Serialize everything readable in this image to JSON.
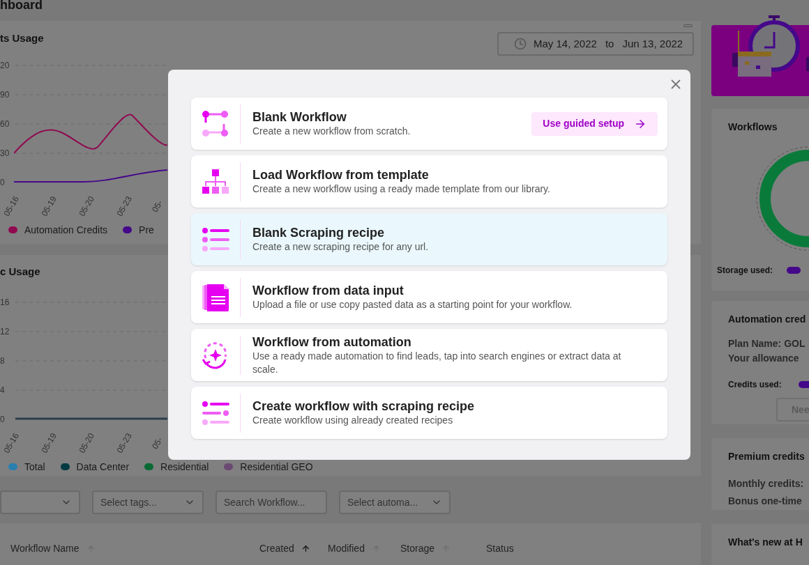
{
  "page_title": "hboard",
  "credits_chart": {
    "title": "ts Usage",
    "date_from": "May 14, 2022",
    "date_sep": "to",
    "date_to": "Jun 13, 2022",
    "y_ticks": [
      "20",
      "90",
      "60",
      "30",
      "0"
    ],
    "x_ticks": [
      "05-16",
      "05-19",
      "05-20",
      "05-23",
      "05-"
    ],
    "legend": [
      {
        "label": "Automation Credits",
        "color": "#8f0a50"
      },
      {
        "label": "Pre",
        "color": "#45088a"
      }
    ]
  },
  "traffic_chart": {
    "title": "c Usage",
    "y_ticks": [
      "16",
      "12",
      "8",
      "4",
      "0"
    ],
    "x_ticks": [
      "05-16",
      "05-19",
      "05-20",
      "05-23",
      "05-"
    ],
    "legend": [
      {
        "label": "Total",
        "color": "#2a7fb0"
      },
      {
        "label": "Data Center",
        "color": "#053a42"
      },
      {
        "label": "Residential",
        "color": "#0a6a34"
      },
      {
        "label": "Residential GEO",
        "color": "#6a4a72"
      }
    ]
  },
  "filters": [
    {
      "kind": "select"
    },
    {
      "kind": "select",
      "placeholder": "Select tags..."
    },
    {
      "kind": "search",
      "placeholder": "Search Workflow..."
    },
    {
      "kind": "select",
      "placeholder": "Select automa..."
    }
  ],
  "table": {
    "columns": [
      {
        "label": "Workflow Name",
        "sorted": false
      },
      {
        "label": "Created",
        "sorted": true
      },
      {
        "label": "Modified",
        "sorted": false
      },
      {
        "label": "Storage",
        "sorted": false
      },
      {
        "label": "Status"
      }
    ]
  },
  "side": {
    "workflows": {
      "title": "Workflows",
      "storage_label": "Storage used:"
    },
    "automation": {
      "title": "Automation cred",
      "plan": "Plan Name: GOL",
      "allowance": "Your allowance",
      "credits_label": "Credits used:",
      "button": "Nee"
    },
    "premium": {
      "title": "Premium credits",
      "monthly": "Monthly credits:",
      "bonus": "Bonus one-time"
    },
    "news": {
      "title": "What's new at H"
    }
  },
  "modal": {
    "options": [
      {
        "kind": "nodes",
        "title": "Blank Workflow",
        "description": "Create a new workflow from scratch.",
        "selected": false,
        "action": "Use guided setup"
      },
      {
        "kind": "hierarchy",
        "title": "Load Workflow from template",
        "description": "Create a new workflow using a ready made template from our library.",
        "selected": false
      },
      {
        "kind": "list",
        "title": "Blank Scraping recipe",
        "description": "Create a new scraping recipe for any url.",
        "selected": true
      },
      {
        "kind": "document",
        "title": "Workflow from data input",
        "description": "Upload a file or use copy pasted data as a starting point for your workflow.",
        "selected": false
      },
      {
        "kind": "automation",
        "title": "Workflow from automation",
        "description": "Use a ready made automation to find leads, tap into search engines or extract data at scale.",
        "selected": false
      },
      {
        "kind": "recipe",
        "title": "Create workflow with scraping recipe",
        "description": "Create workflow using already created recipes",
        "selected": false
      }
    ]
  }
}
